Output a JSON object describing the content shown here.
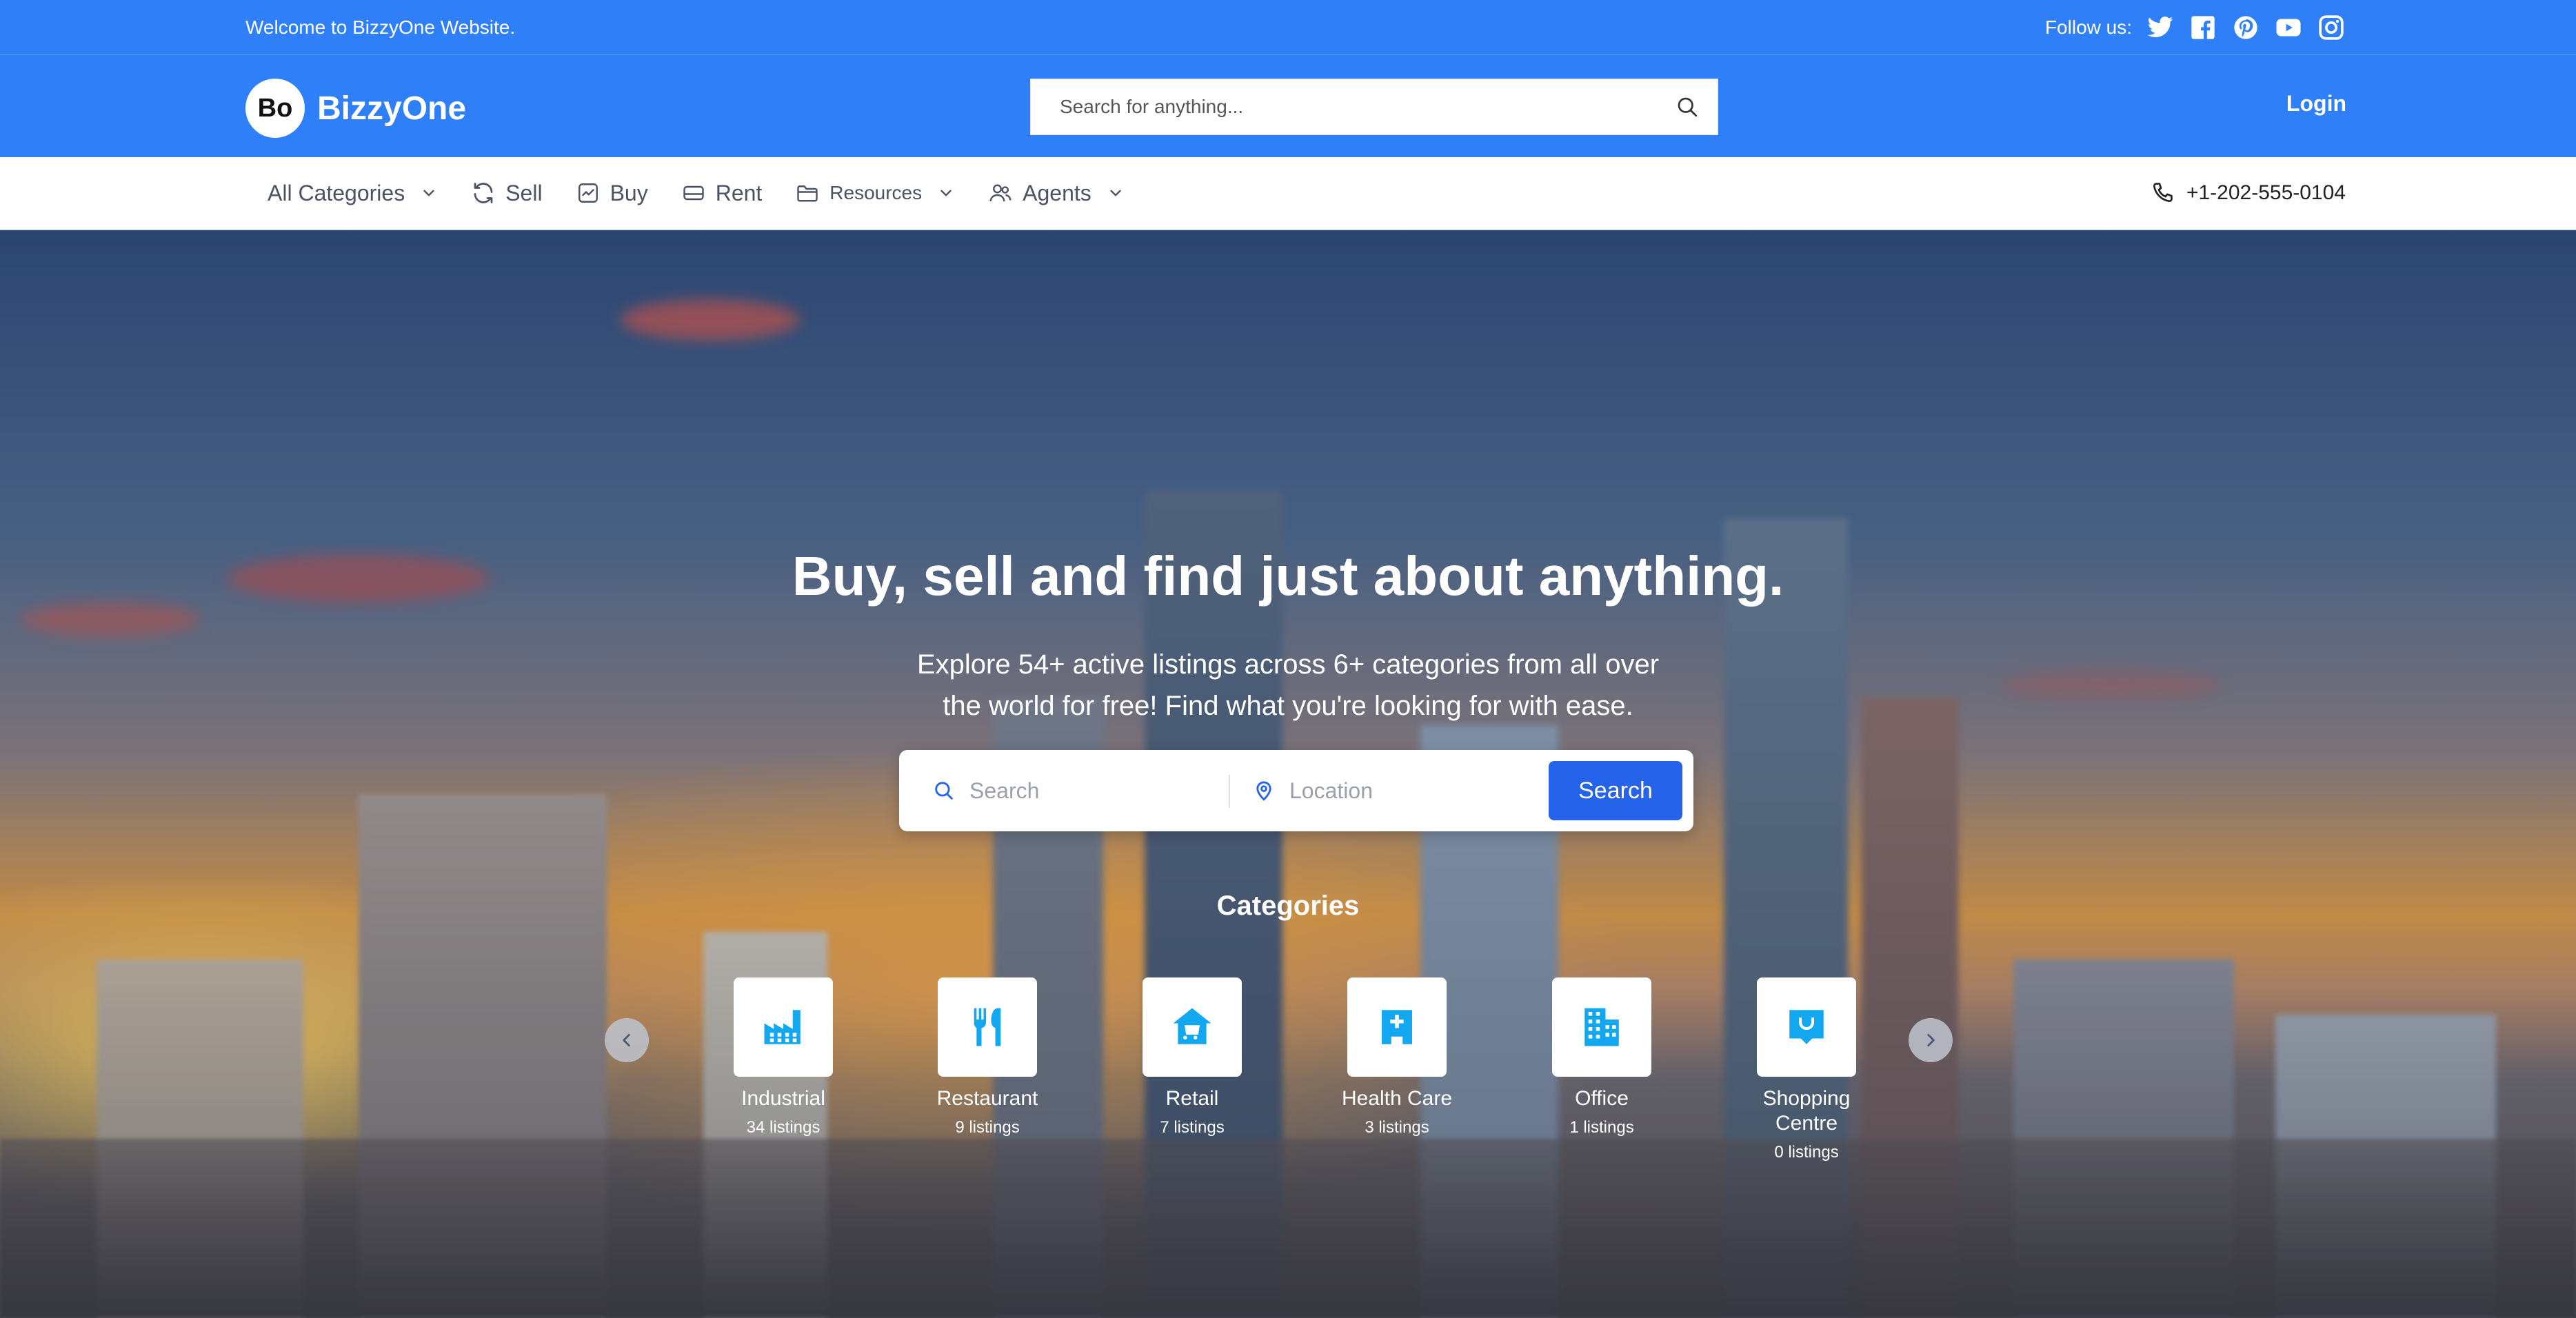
{
  "topbar": {
    "welcome": "Welcome to BizzyOne Website.",
    "follow_label": "Follow us:",
    "social": [
      "twitter-icon",
      "facebook-icon",
      "pinterest-icon",
      "youtube-icon",
      "instagram-icon"
    ]
  },
  "header": {
    "logo_badge": "Bo",
    "logo_text": "BizzyOne",
    "search_placeholder": "Search for anything...",
    "login": "Login"
  },
  "nav": {
    "items": [
      {
        "label": "All Categories",
        "icon": "",
        "dropdown": true
      },
      {
        "label": "Sell",
        "icon": "refresh-icon",
        "dropdown": false
      },
      {
        "label": "Buy",
        "icon": "chart-icon",
        "dropdown": false
      },
      {
        "label": "Rent",
        "icon": "card-icon",
        "dropdown": false
      },
      {
        "label": "Resources",
        "icon": "folder-icon",
        "dropdown": true
      },
      {
        "label": "Agents",
        "icon": "users-icon",
        "dropdown": true
      }
    ],
    "phone": "+1-202-555-0104"
  },
  "hero": {
    "title": "Buy, sell and find just about anything.",
    "subtitle": "Explore 54+ active listings across 6+ categories from all over the world for free! Find what you're looking for with ease.",
    "search_placeholder": "Search",
    "location_placeholder": "Location",
    "search_button": "Search"
  },
  "categories": {
    "title": "Categories",
    "items": [
      {
        "name": "Industrial",
        "count": "34 listings",
        "icon": "factory-icon"
      },
      {
        "name": "Restaurant",
        "count": "9 listings",
        "icon": "utensils-icon"
      },
      {
        "name": "Retail",
        "count": "7 listings",
        "icon": "store-icon"
      },
      {
        "name": "Health Care",
        "count": "3 listings",
        "icon": "hospital-icon"
      },
      {
        "name": "Office",
        "count": "1 listings",
        "icon": "office-building-icon"
      },
      {
        "name": "Shopping Centre",
        "count": "0 listings",
        "icon": "shopping-centre-icon"
      }
    ]
  },
  "colors": {
    "brand_blue": "#2f7ff8",
    "button_blue": "#2563eb",
    "icon_cyan": "#12a7ee"
  }
}
